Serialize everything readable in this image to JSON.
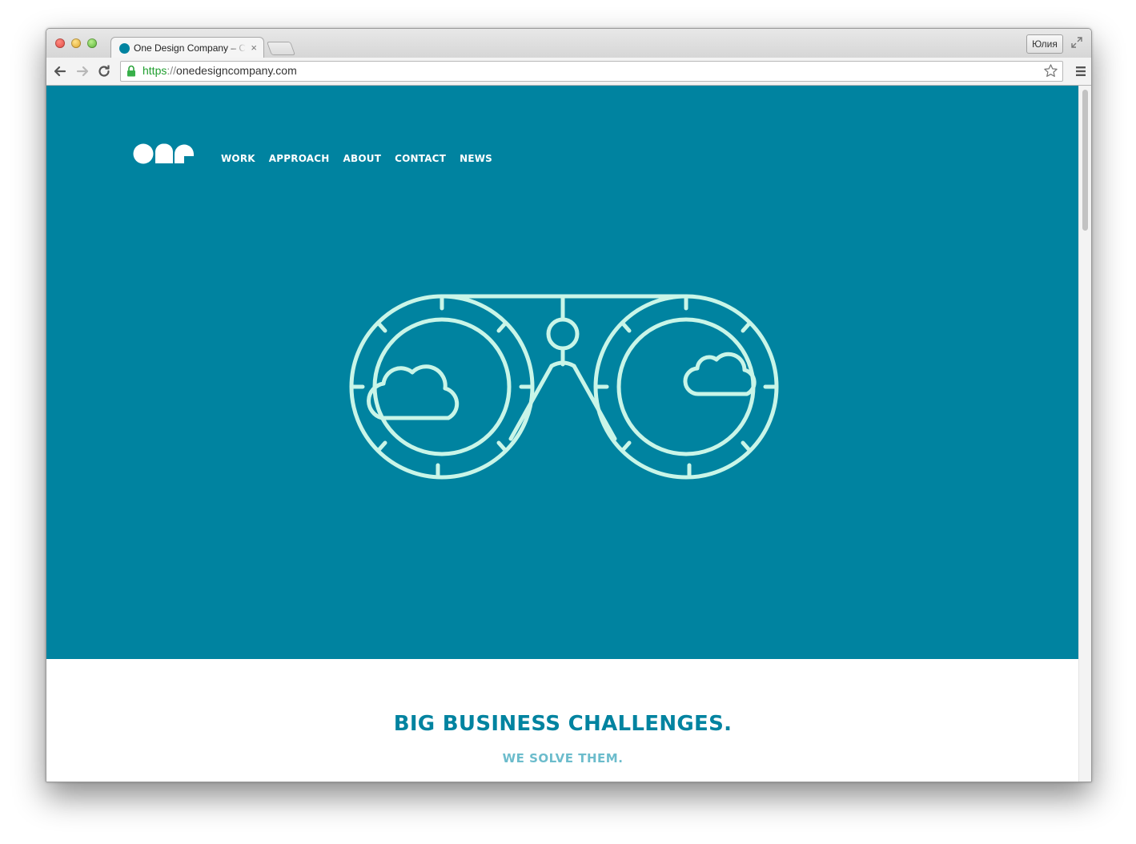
{
  "browser": {
    "tab_title": "One Design Company – Chicago",
    "tab_close": "×",
    "profile_name": "Юлия",
    "url_scheme": "https",
    "url_separator": "://",
    "url_host": "onedesigncompany.com",
    "favicon_color": "#0083a0"
  },
  "site": {
    "logo": "one",
    "nav": [
      "WORK",
      "APPROACH",
      "ABOUT",
      "CONTACT",
      "NEWS"
    ],
    "hero_color": "#0083a0",
    "illustration_stroke": "#c9f5e8",
    "hero_illustration": "binoculars-with-clouds"
  },
  "content": {
    "headline": "BIG BUSINESS CHALLENGES.",
    "subhead": "WE SOLVE THEM.",
    "headline_color": "#0083a0",
    "subhead_color": "#6cbccc"
  }
}
